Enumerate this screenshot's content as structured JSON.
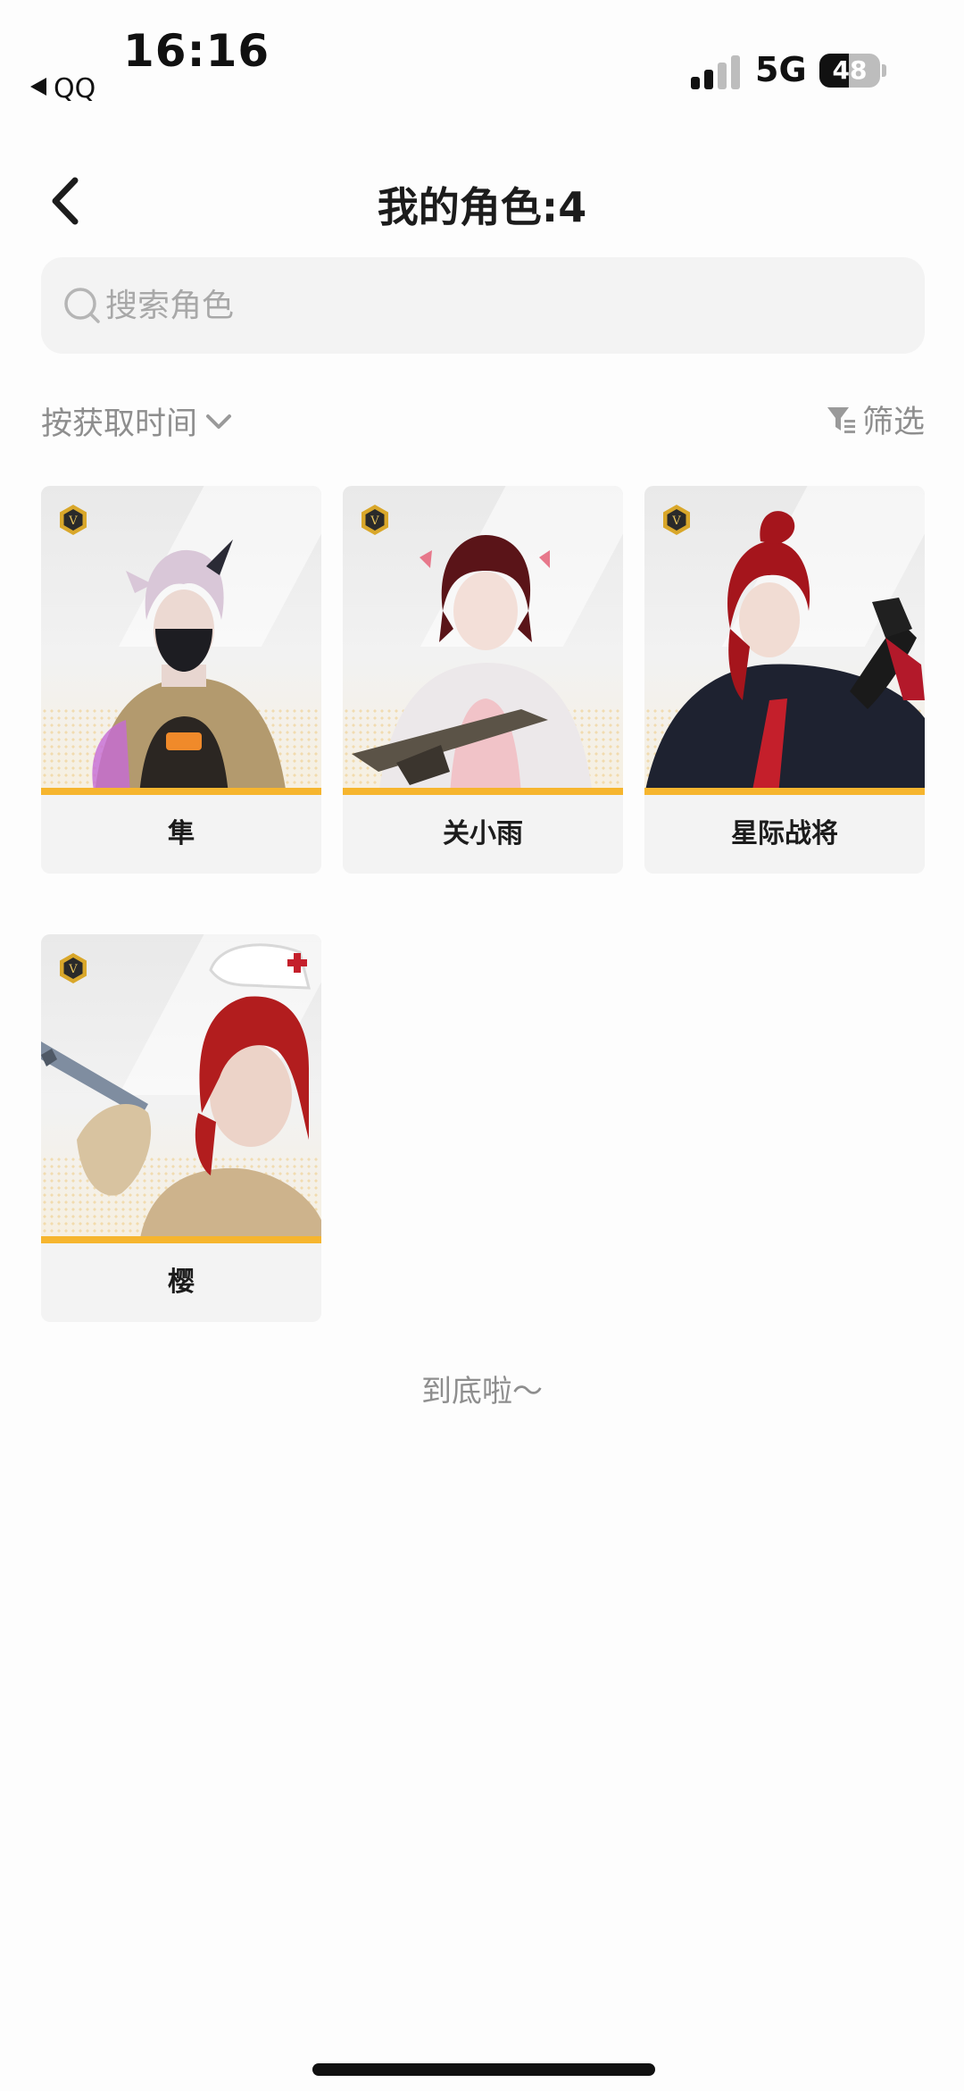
{
  "status_bar": {
    "time": "16:16",
    "back_app_label": "QQ",
    "network": "5G",
    "battery": "48",
    "battery_level": 0.48
  },
  "header": {
    "title": "我的角色:4",
    "back_icon": "chevron-left-icon"
  },
  "search": {
    "placeholder": "搜索角色",
    "value": "",
    "icon": "search-icon"
  },
  "toolbar": {
    "sort_label": "按获取时间",
    "filter_label": "筛选",
    "filter_icon": "funnel-icon"
  },
  "characters": [
    {
      "name": "隼",
      "badge": "V"
    },
    {
      "name": "关小雨",
      "badge": "V"
    },
    {
      "name": "星际战将",
      "badge": "V"
    },
    {
      "name": "樱",
      "badge": "V"
    }
  ],
  "footer": {
    "end_text": "到底啦～"
  },
  "colors": {
    "accent_band": "#f6b52e",
    "badge_gold": "#d9a72a",
    "card_bg": "#f3f3f3",
    "muted_text": "#8e8e8e"
  }
}
